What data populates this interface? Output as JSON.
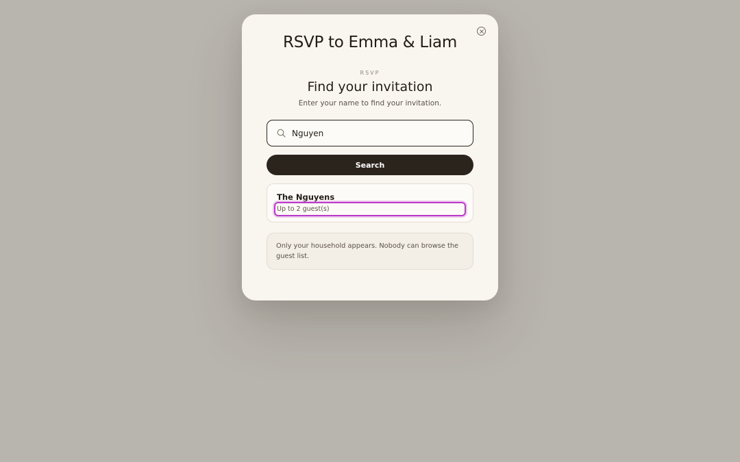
{
  "modal": {
    "title": "RSVP to Emma & Liam",
    "close_icon": "close-circle-icon"
  },
  "rsvp": {
    "eyebrow": "RSVP",
    "heading": "Find your invitation",
    "subtext": "Enter your name to find your invitation."
  },
  "search": {
    "icon": "search-icon",
    "value": "Nguyen",
    "button_label": "Search"
  },
  "result": {
    "household_name": "The Nguyens",
    "guests_label": "Up to 2 guest(s)"
  },
  "note": {
    "text": "Only your household appears. Nobody can browse the guest list."
  },
  "colors": {
    "backdrop": "#b8b5ae",
    "modal_bg": "#f9f6f0",
    "primary_dark": "#2b241d",
    "focus_ring": "#b93bc8"
  }
}
